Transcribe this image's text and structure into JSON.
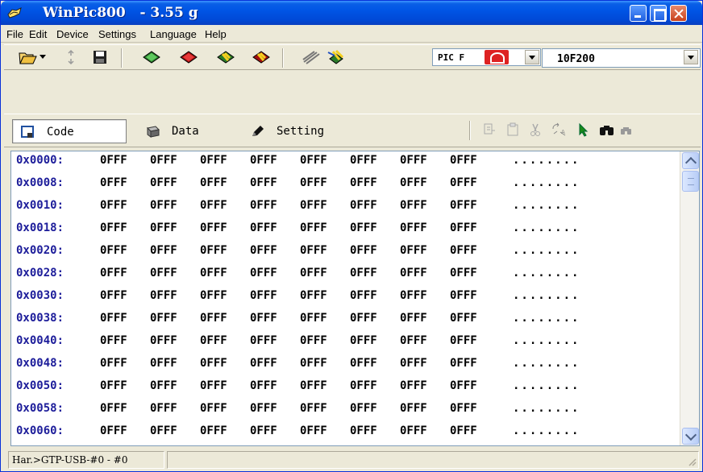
{
  "window": {
    "title": "WinPic800   - 3.55 g",
    "icons": {
      "app": "winpic-app-icon",
      "minimize": "minimize-icon",
      "maximize": "maximize-icon",
      "close": "close-icon"
    }
  },
  "menu": {
    "items": [
      "File",
      "Edit",
      "Device",
      "Settings",
      "Language",
      "Help"
    ]
  },
  "toolbar": {
    "tools": [
      "open-folder-icon",
      "refresh-icon",
      "save-icon",
      "read-chip-icon",
      "program-chip-icon",
      "verify-chip-icon",
      "erase-chip-icon",
      "hardware-test-icon",
      "device-detect-icon"
    ],
    "family_select": {
      "value": "PIC F",
      "logo": "microchip-logo-icon"
    },
    "device_select": {
      "value": "10F200"
    }
  },
  "view_tabs": {
    "tabs": [
      {
        "label": "Code",
        "icon": "code-memory-icon",
        "active": true
      },
      {
        "label": "Data",
        "icon": "data-memory-icon",
        "active": false
      },
      {
        "label": "Setting",
        "icon": "setting-pencil-icon",
        "active": false
      }
    ],
    "edit_tools": [
      "copy-disabled-icon",
      "paste-disabled-icon",
      "cut-disabled-icon",
      "fill-icon",
      "goto-cursor-icon",
      "find-icon",
      "find-next-icon"
    ]
  },
  "hex_view": {
    "rows": [
      {
        "address": "0x0000:",
        "words": [
          "0FFF",
          "0FFF",
          "0FFF",
          "0FFF",
          "0FFF",
          "0FFF",
          "0FFF",
          "0FFF"
        ],
        "ascii": "........"
      },
      {
        "address": "0x0008:",
        "words": [
          "0FFF",
          "0FFF",
          "0FFF",
          "0FFF",
          "0FFF",
          "0FFF",
          "0FFF",
          "0FFF"
        ],
        "ascii": "........"
      },
      {
        "address": "0x0010:",
        "words": [
          "0FFF",
          "0FFF",
          "0FFF",
          "0FFF",
          "0FFF",
          "0FFF",
          "0FFF",
          "0FFF"
        ],
        "ascii": "........"
      },
      {
        "address": "0x0018:",
        "words": [
          "0FFF",
          "0FFF",
          "0FFF",
          "0FFF",
          "0FFF",
          "0FFF",
          "0FFF",
          "0FFF"
        ],
        "ascii": "........"
      },
      {
        "address": "0x0020:",
        "words": [
          "0FFF",
          "0FFF",
          "0FFF",
          "0FFF",
          "0FFF",
          "0FFF",
          "0FFF",
          "0FFF"
        ],
        "ascii": "........"
      },
      {
        "address": "0x0028:",
        "words": [
          "0FFF",
          "0FFF",
          "0FFF",
          "0FFF",
          "0FFF",
          "0FFF",
          "0FFF",
          "0FFF"
        ],
        "ascii": "........"
      },
      {
        "address": "0x0030:",
        "words": [
          "0FFF",
          "0FFF",
          "0FFF",
          "0FFF",
          "0FFF",
          "0FFF",
          "0FFF",
          "0FFF"
        ],
        "ascii": "........"
      },
      {
        "address": "0x0038:",
        "words": [
          "0FFF",
          "0FFF",
          "0FFF",
          "0FFF",
          "0FFF",
          "0FFF",
          "0FFF",
          "0FFF"
        ],
        "ascii": "........"
      },
      {
        "address": "0x0040:",
        "words": [
          "0FFF",
          "0FFF",
          "0FFF",
          "0FFF",
          "0FFF",
          "0FFF",
          "0FFF",
          "0FFF"
        ],
        "ascii": "........"
      },
      {
        "address": "0x0048:",
        "words": [
          "0FFF",
          "0FFF",
          "0FFF",
          "0FFF",
          "0FFF",
          "0FFF",
          "0FFF",
          "0FFF"
        ],
        "ascii": "........"
      },
      {
        "address": "0x0050:",
        "words": [
          "0FFF",
          "0FFF",
          "0FFF",
          "0FFF",
          "0FFF",
          "0FFF",
          "0FFF",
          "0FFF"
        ],
        "ascii": "........"
      },
      {
        "address": "0x0058:",
        "words": [
          "0FFF",
          "0FFF",
          "0FFF",
          "0FFF",
          "0FFF",
          "0FFF",
          "0FFF",
          "0FFF"
        ],
        "ascii": "........"
      },
      {
        "address": "0x0060:",
        "words": [
          "0FFF",
          "0FFF",
          "0FFF",
          "0FFF",
          "0FFF",
          "0FFF",
          "0FFF",
          "0FFF"
        ],
        "ascii": "........"
      }
    ],
    "address_color": "#1d1d9a"
  },
  "status": {
    "hardware": "Har.>GTP-USB-#0 - #0"
  }
}
